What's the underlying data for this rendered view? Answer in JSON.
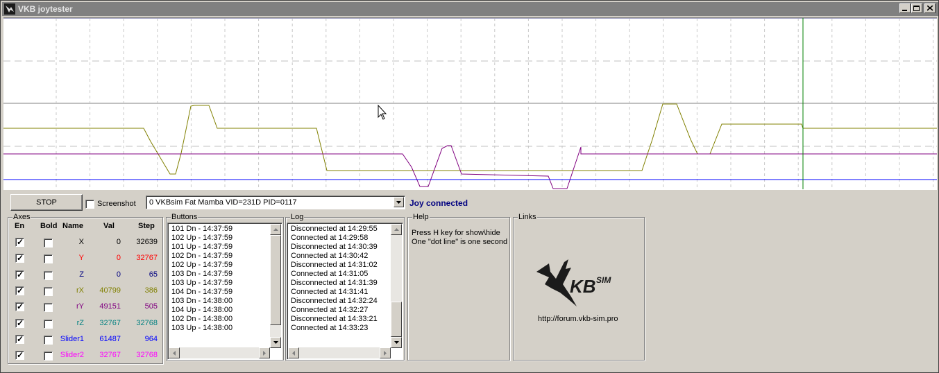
{
  "window": {
    "title": "VKB joytester"
  },
  "toolbar": {
    "stop_label": "STOP",
    "screenshot_label": "Screenshot",
    "screenshot_checked": false,
    "device_value": "0 VKBsim Fat Mamba  VID=231D PID=0117",
    "status": "Joy connected"
  },
  "axes": {
    "group_label": "Axes",
    "headers": {
      "en": "En",
      "bold": "Bold",
      "name": "Name",
      "val": "Val",
      "step": "Step"
    },
    "rows": [
      {
        "name": "X",
        "val": "0",
        "step": "32639",
        "color": "#000000",
        "enabled": true,
        "bold": false
      },
      {
        "name": "Y",
        "val": "0",
        "step": "32767",
        "color": "#ff0000",
        "enabled": true,
        "bold": false
      },
      {
        "name": "Z",
        "val": "0",
        "step": "65",
        "color": "#000080",
        "enabled": true,
        "bold": false
      },
      {
        "name": "rX",
        "val": "40799",
        "step": "386",
        "color": "#808000",
        "enabled": true,
        "bold": false
      },
      {
        "name": "rY",
        "val": "49151",
        "step": "505",
        "color": "#800080",
        "enabled": true,
        "bold": false
      },
      {
        "name": "rZ",
        "val": "32767",
        "step": "32768",
        "color": "#008080",
        "enabled": true,
        "bold": false
      },
      {
        "name": "Slider1",
        "val": "61487",
        "step": "964",
        "color": "#0000ff",
        "enabled": true,
        "bold": false
      },
      {
        "name": "Slider2",
        "val": "32767",
        "step": "32768",
        "color": "#ff00ff",
        "enabled": true,
        "bold": false
      }
    ]
  },
  "buttons_panel": {
    "group_label": "Buttons",
    "lines": [
      "101 Dn - 14:37:59",
      "102 Up - 14:37:59",
      "101 Up - 14:37:59",
      "102 Dn - 14:37:59",
      "102 Up - 14:37:59",
      "103 Dn - 14:37:59",
      "103 Up - 14:37:59",
      "104 Dn - 14:37:59",
      "103 Dn - 14:38:00",
      "104 Up - 14:38:00",
      "102 Dn - 14:38:00",
      "103 Up - 14:38:00"
    ]
  },
  "log_panel": {
    "group_label": "Log",
    "lines": [
      "Disconnected at 14:29:55",
      "Connected at 14:29:58",
      "Disconnected at 14:30:39",
      "Connected at 14:30:42",
      "Disconnected at 14:31:02",
      "Connected at 14:31:05",
      "Disconnected at 14:31:39",
      "Connected at 14:31:41",
      "Disconnected at 14:32:24",
      "Connected at 14:32:27",
      "Disconnected at 14:33:21",
      "Connected at 14:33:23"
    ]
  },
  "help_panel": {
    "group_label": "Help",
    "lines": [
      "Press H key for show\\hide",
      "One \"dot line\" is one second"
    ]
  },
  "links_panel": {
    "group_label": "Links",
    "logo_text": "VKBsim",
    "url": "http://forum.vkb-sim.pro"
  },
  "plot_colors": {
    "rX": "#808000",
    "rY": "#800080",
    "Slider1": "#0000ff",
    "cursor": "#008000"
  }
}
